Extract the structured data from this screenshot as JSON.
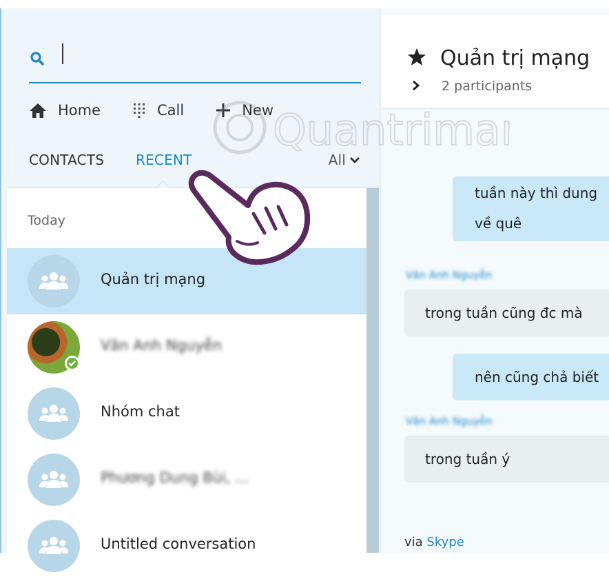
{
  "search": {
    "placeholder": ""
  },
  "nav": {
    "home": "Home",
    "call": "Call",
    "new": "New"
  },
  "tabs": {
    "contacts": "CONTACTS",
    "recent": "RECENT",
    "filter": "All"
  },
  "list": {
    "section": "Today",
    "items": [
      {
        "label": "Quản trị mạng",
        "type": "group",
        "selected": true
      },
      {
        "label": "Văn Anh Nguyễn",
        "type": "person",
        "online": true
      },
      {
        "label": "Nhóm chat",
        "type": "group"
      },
      {
        "label": "Phương Dung Bùi, ...",
        "type": "group"
      },
      {
        "label": "Untitled conversation",
        "type": "group"
      }
    ]
  },
  "chat": {
    "title": "Quản trị mạng",
    "participants": "2 participants",
    "messages": [
      {
        "dir": "out",
        "lines": [
          "tuần này thì dung",
          "về quê"
        ]
      },
      {
        "dir": "in",
        "sender": "Văn Anh Nguyễn",
        "text": "trong tuần cũng đc mà"
      },
      {
        "dir": "out",
        "text": "nên cũng chả biết"
      },
      {
        "dir": "in",
        "sender": "Văn Anh Nguyễn",
        "text": "trong tuần ý"
      }
    ],
    "via_prefix": "via",
    "via_link": "Skype"
  },
  "watermark": "Quantrimang",
  "colors": {
    "accent": "#1c88c7",
    "selected": "#c6e6f7",
    "outgoing": "#c9e8f8",
    "online": "#6cb33e"
  }
}
